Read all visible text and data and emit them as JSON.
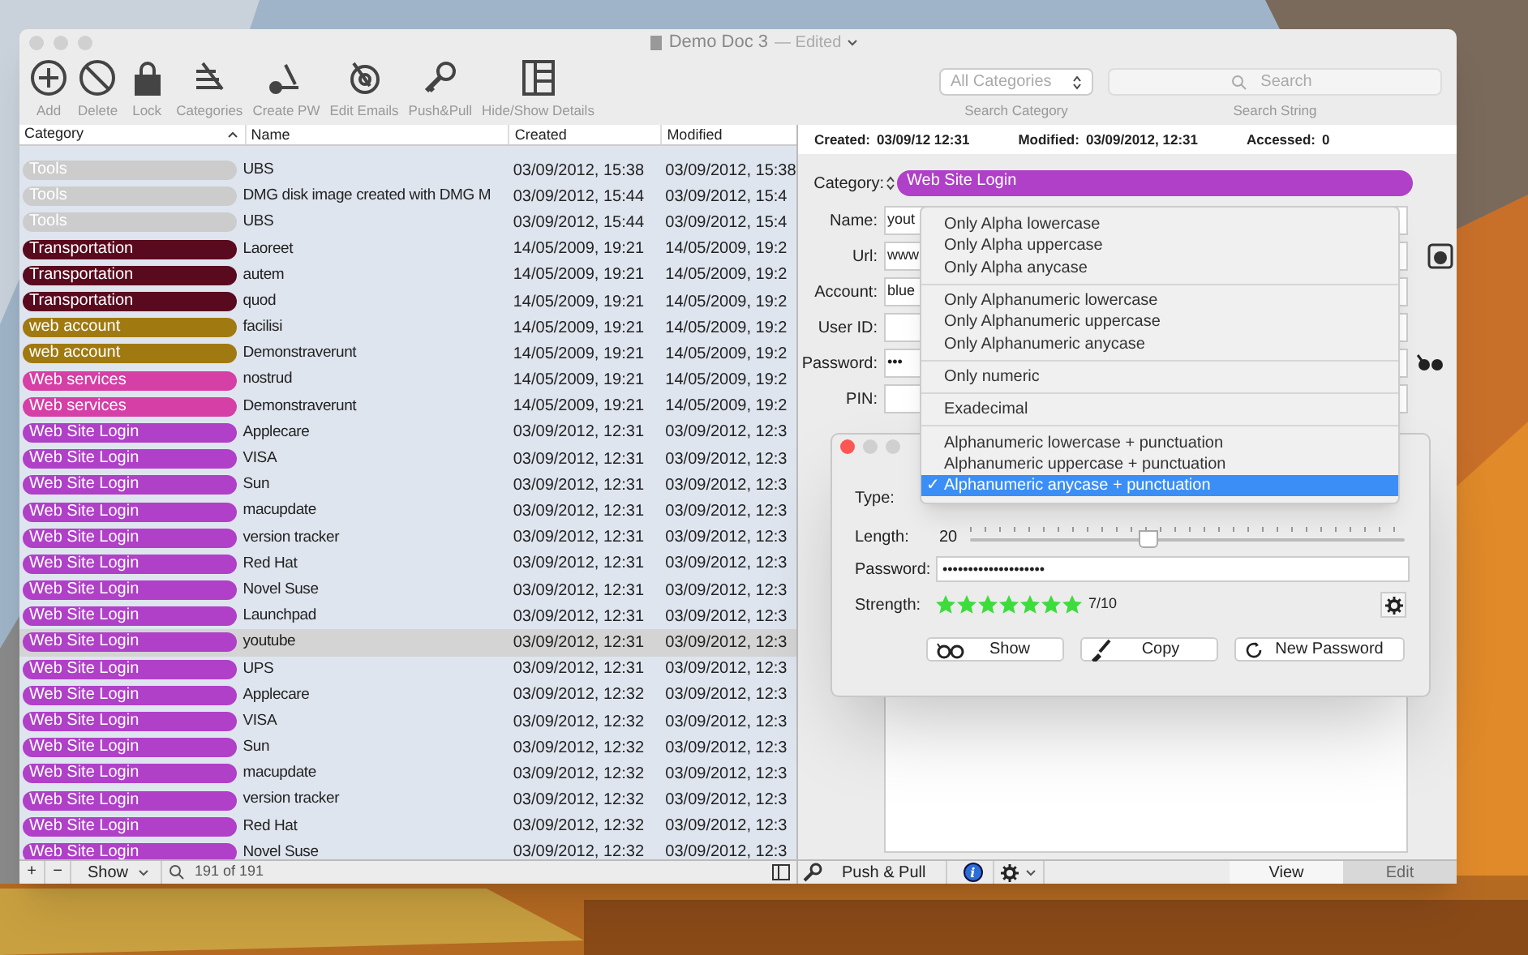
{
  "window": {
    "title": "Demo Doc 3",
    "subtitle": "— Edited"
  },
  "toolbar": [
    {
      "label": "Add",
      "kind": "add"
    },
    {
      "label": "Delete",
      "kind": "delete"
    },
    {
      "label": "Lock",
      "kind": "lock"
    },
    {
      "label": "Categories",
      "kind": "categories"
    },
    {
      "label": "Create PW",
      "kind": "createpw"
    },
    {
      "label": "Edit Emails",
      "kind": "emails"
    },
    {
      "label": "Push&Pull",
      "kind": "pushpull"
    },
    {
      "label": "Hide/Show Details",
      "kind": "details"
    }
  ],
  "search": {
    "category_value": "All Categories",
    "category_caption": "Search Category",
    "placeholder": "Search",
    "search_caption": "Search String"
  },
  "table": {
    "columns": [
      "Category",
      "Name",
      "Created",
      "Modified"
    ],
    "rows": [
      {
        "category": "Tools",
        "color": "#cccccc",
        "name": "UBS",
        "created": "03/09/2012, 15:38",
        "modified": "03/09/2012, 15:38",
        "selected": false
      },
      {
        "category": "Tools",
        "color": "#cccccc",
        "name": "DMG disk image created with DMG M",
        "created": "03/09/2012, 15:44",
        "modified": "03/09/2012, 15:4",
        "selected": false
      },
      {
        "category": "Tools",
        "color": "#cccccc",
        "name": "UBS",
        "created": "03/09/2012, 15:44",
        "modified": "03/09/2012, 15:4",
        "selected": false
      },
      {
        "category": "Transportation",
        "color": "#5a0a1e",
        "name": "Laoreet",
        "created": "14/05/2009, 19:21",
        "modified": "14/05/2009, 19:2",
        "selected": false
      },
      {
        "category": "Transportation",
        "color": "#5a0a1e",
        "name": "autem",
        "created": "14/05/2009, 19:21",
        "modified": "14/05/2009, 19:2",
        "selected": false
      },
      {
        "category": "Transportation",
        "color": "#5a0a1e",
        "name": "quod",
        "created": "14/05/2009, 19:21",
        "modified": "14/05/2009, 19:2",
        "selected": false
      },
      {
        "category": "web account",
        "color": "#a07a10",
        "name": "facilisi",
        "created": "14/05/2009, 19:21",
        "modified": "14/05/2009, 19:2",
        "selected": false
      },
      {
        "category": "web account",
        "color": "#a07a10",
        "name": "Demonstraverunt",
        "created": "14/05/2009, 19:21",
        "modified": "14/05/2009, 19:2",
        "selected": false
      },
      {
        "category": "Web services",
        "color": "#d63fa6",
        "name": "nostrud",
        "created": "14/05/2009, 19:21",
        "modified": "14/05/2009, 19:2",
        "selected": false
      },
      {
        "category": "Web services",
        "color": "#d63fa6",
        "name": "Demonstraverunt",
        "created": "14/05/2009, 19:21",
        "modified": "14/05/2009, 19:2",
        "selected": false
      },
      {
        "category": "Web Site Login",
        "color": "#b040c8",
        "name": "Applecare",
        "created": "03/09/2012, 12:31",
        "modified": "03/09/2012, 12:3",
        "selected": false
      },
      {
        "category": "Web Site Login",
        "color": "#b040c8",
        "name": "VISA",
        "created": "03/09/2012, 12:31",
        "modified": "03/09/2012, 12:3",
        "selected": false
      },
      {
        "category": "Web Site Login",
        "color": "#b040c8",
        "name": "Sun",
        "created": "03/09/2012, 12:31",
        "modified": "03/09/2012, 12:3",
        "selected": false
      },
      {
        "category": "Web Site Login",
        "color": "#b040c8",
        "name": "macupdate",
        "created": "03/09/2012, 12:31",
        "modified": "03/09/2012, 12:3",
        "selected": false
      },
      {
        "category": "Web Site Login",
        "color": "#b040c8",
        "name": "version tracker",
        "created": "03/09/2012, 12:31",
        "modified": "03/09/2012, 12:3",
        "selected": false
      },
      {
        "category": "Web Site Login",
        "color": "#b040c8",
        "name": "Red Hat",
        "created": "03/09/2012, 12:31",
        "modified": "03/09/2012, 12:3",
        "selected": false
      },
      {
        "category": "Web Site Login",
        "color": "#b040c8",
        "name": "Novel Suse",
        "created": "03/09/2012, 12:31",
        "modified": "03/09/2012, 12:3",
        "selected": false
      },
      {
        "category": "Web Site Login",
        "color": "#b040c8",
        "name": "Launchpad",
        "created": "03/09/2012, 12:31",
        "modified": "03/09/2012, 12:3",
        "selected": false
      },
      {
        "category": "Web Site Login",
        "color": "#b040c8",
        "name": "youtube",
        "created": "03/09/2012, 12:31",
        "modified": "03/09/2012, 12:3",
        "selected": true
      },
      {
        "category": "Web Site Login",
        "color": "#b040c8",
        "name": "UPS",
        "created": "03/09/2012, 12:31",
        "modified": "03/09/2012, 12:3",
        "selected": false
      },
      {
        "category": "Web Site Login",
        "color": "#b040c8",
        "name": "Applecare",
        "created": "03/09/2012, 12:32",
        "modified": "03/09/2012, 12:3",
        "selected": false
      },
      {
        "category": "Web Site Login",
        "color": "#b040c8",
        "name": "VISA",
        "created": "03/09/2012, 12:32",
        "modified": "03/09/2012, 12:3",
        "selected": false
      },
      {
        "category": "Web Site Login",
        "color": "#b040c8",
        "name": "Sun",
        "created": "03/09/2012, 12:32",
        "modified": "03/09/2012, 12:3",
        "selected": false
      },
      {
        "category": "Web Site Login",
        "color": "#b040c8",
        "name": "macupdate",
        "created": "03/09/2012, 12:32",
        "modified": "03/09/2012, 12:3",
        "selected": false
      },
      {
        "category": "Web Site Login",
        "color": "#b040c8",
        "name": "version tracker",
        "created": "03/09/2012, 12:32",
        "modified": "03/09/2012, 12:3",
        "selected": false
      },
      {
        "category": "Web Site Login",
        "color": "#b040c8",
        "name": "Red Hat",
        "created": "03/09/2012, 12:32",
        "modified": "03/09/2012, 12:3",
        "selected": false
      },
      {
        "category": "Web Site Login",
        "color": "#b040c8",
        "name": "Novel Suse",
        "created": "03/09/2012, 12:32",
        "modified": "03/09/2012, 12:3",
        "selected": false
      }
    ]
  },
  "info_bar": [
    {
      "label": "Created:",
      "value": "03/09/12 12:31"
    },
    {
      "label": "Modified:",
      "value": "03/09/2012, 12:31"
    },
    {
      "label": "Accessed:",
      "value": "0"
    }
  ],
  "detail": {
    "category_label": "Category:",
    "category": "Web Site Login",
    "fields": [
      {
        "label": "Name:",
        "value": "yout"
      },
      {
        "label": "Url:",
        "value": "www"
      },
      {
        "label": "Account:",
        "value": "blue"
      },
      {
        "label": "User ID:"
      },
      {
        "label": "Password:",
        "value": "•••"
      },
      {
        "label": "PIN:"
      }
    ]
  },
  "type_menu": [
    [
      {
        "label": "Only Alpha lowercase",
        "selected": false
      },
      {
        "label": "Only Alpha uppercase",
        "selected": false
      },
      {
        "label": "Only Alpha anycase",
        "selected": false
      }
    ],
    [
      {
        "label": "Only Alphanumeric lowercase",
        "selected": false
      },
      {
        "label": "Only Alphanumeric uppercase",
        "selected": false
      },
      {
        "label": "Only Alphanumeric anycase",
        "selected": false
      }
    ],
    [
      {
        "label": "Only numeric",
        "selected": false
      }
    ],
    [
      {
        "label": "Exadecimal",
        "selected": false
      }
    ],
    [
      {
        "label": "Alphanumeric lowercase + punctuation",
        "selected": false
      },
      {
        "label": "Alphanumeric uppercase + punctuation",
        "selected": false
      },
      {
        "label": "Alphanumeric anycase + punctuation",
        "selected": true
      }
    ]
  ],
  "check_mark": "✓",
  "generator": {
    "type_label": "Type:",
    "length_label": "Length:",
    "length": "20",
    "level": 0.41,
    "password_label": "Password:",
    "password": "••••••••••••••••••••",
    "strength_label": "Strength:",
    "stars": 7,
    "strength": "7/10",
    "buttons": [
      {
        "label": "Show",
        "kind": "show"
      },
      {
        "label": "Copy",
        "kind": "copy"
      },
      {
        "label": "New Password",
        "kind": "new"
      }
    ]
  },
  "bottom_bar": {
    "add": "+",
    "remove": "−",
    "info": "i",
    "show": "Show",
    "count": "191 of 191",
    "push_pull": "Push & Pull",
    "tabs": [
      {
        "label": "View",
        "selected": true
      },
      {
        "label": "Edit",
        "selected": false
      }
    ]
  }
}
